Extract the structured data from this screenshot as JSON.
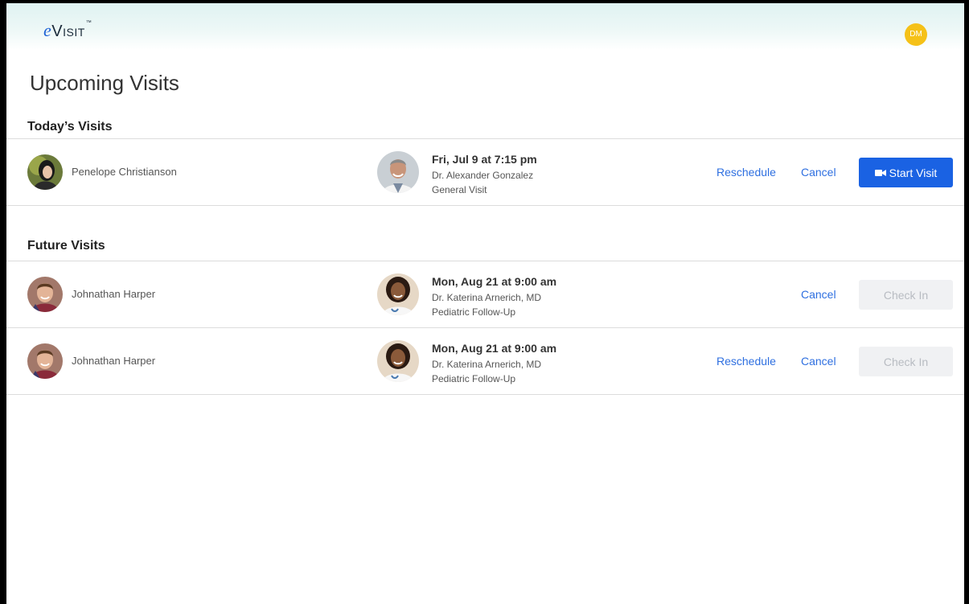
{
  "header": {
    "logo_e": "e",
    "logo_text": "Visit",
    "logo_tm": "™",
    "user_initials": "DM"
  },
  "page": {
    "title": "Upcoming Visits"
  },
  "sections": {
    "today": {
      "title": "Today’s Visits",
      "visits": [
        {
          "patient": "Penelope Christianson",
          "time": "Fri, Jul 9 at 7:15 pm",
          "doctor": "Dr. Alexander Gonzalez",
          "type": "General Visit",
          "reschedule_label": "Reschedule",
          "cancel_label": "Cancel",
          "action_label": "Start Visit",
          "action_icon": "video-camera-icon"
        }
      ]
    },
    "future": {
      "title": "Future Visits",
      "visits": [
        {
          "patient": "Johnathan Harper",
          "time": "Mon, Aug 21 at 9:00 am",
          "doctor": "Dr. Katerina Arnerich, MD",
          "type": "Pediatric Follow-Up",
          "cancel_label": "Cancel",
          "action_label": "Check In"
        },
        {
          "patient": "Johnathan Harper",
          "time": "Mon, Aug 21 at 9:00 am",
          "doctor": "Dr. Katerina Arnerich, MD",
          "type": "Pediatric Follow-Up",
          "reschedule_label": "Reschedule",
          "cancel_label": "Cancel",
          "action_label": "Check In"
        }
      ]
    }
  },
  "colors": {
    "primary": "#1a62e3",
    "link": "#2e6fe0",
    "user_avatar": "#f5c118",
    "disabled_bg": "#f0f1f3",
    "disabled_text": "#b8bcc2"
  }
}
